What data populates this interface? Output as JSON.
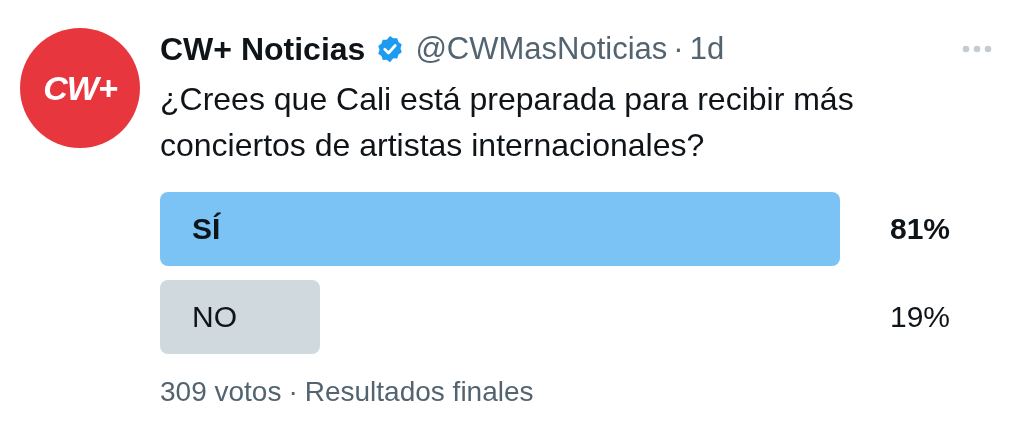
{
  "author": {
    "avatar_text": "CW+",
    "name": "CW+ Noticias",
    "verified": true,
    "handle": "@CWMasNoticias",
    "separator": "·",
    "time": "1d"
  },
  "text": "¿Crees que Cali está preparada para recibir más conciertos de artistas internacionales?",
  "poll": {
    "options": [
      {
        "label": "SÍ",
        "percent": "81%",
        "leading": true
      },
      {
        "label": "NO",
        "percent": "19%",
        "leading": false
      }
    ],
    "votes": "309 votos",
    "separator": "·",
    "status": "Resultados finales"
  }
}
